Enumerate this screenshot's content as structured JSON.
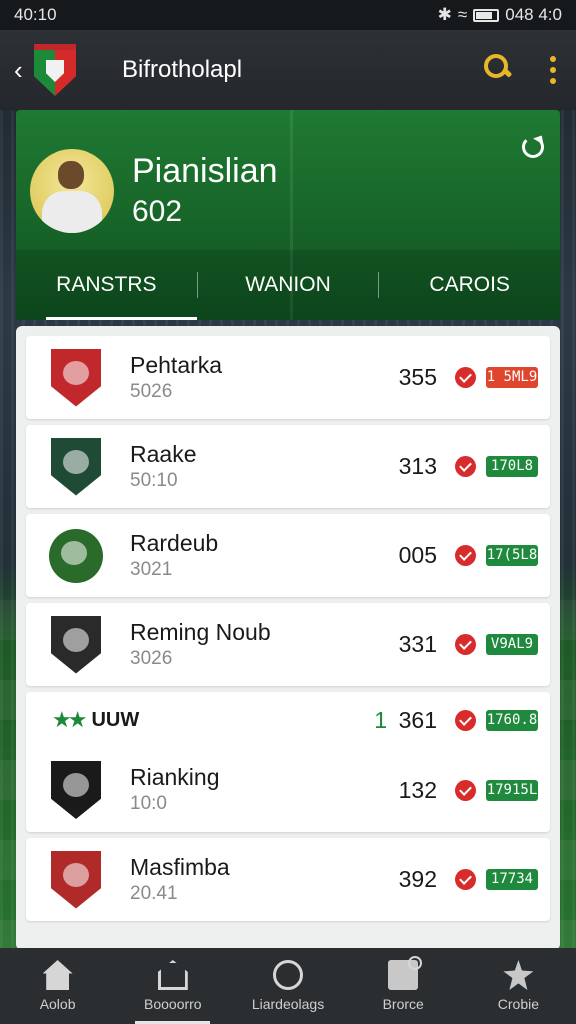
{
  "status_bar": {
    "time": "40:10",
    "right_text": "048 4:0"
  },
  "app_bar": {
    "title": "Bifrotholapl"
  },
  "hero": {
    "name": "Pianislian",
    "number": "602"
  },
  "tabs": [
    {
      "label": "RANSTRS",
      "active": true
    },
    {
      "label": "WANION",
      "active": false
    },
    {
      "label": "CAROIS",
      "active": false
    }
  ],
  "teams": [
    {
      "name": "Pehtarka",
      "sub": "5026",
      "points": "355",
      "badge": "1 5ML9",
      "badge_color": "#e0452e",
      "crest_color": "#c0282b"
    },
    {
      "name": "Raake",
      "sub": "50:10",
      "points": "313",
      "badge": "170L8",
      "badge_color": "#1f8a3e",
      "crest_color": "#1e4a36"
    },
    {
      "name": "Rardeub",
      "sub": "3021",
      "points": "005",
      "badge": "17(5L8",
      "badge_color": "#1f8a3e",
      "crest_color": "#2a6a2a"
    },
    {
      "name": "Reming Noub",
      "sub": "3026",
      "points": "331",
      "badge": "V9AL9",
      "badge_color": "#1f8a3e",
      "crest_color": "#2a2a2a"
    }
  ],
  "group": {
    "label": "UUW",
    "rank": "1",
    "rank_points": "361",
    "rank_badge": "1760.8",
    "team": {
      "name": "Rianking",
      "sub": "10:0",
      "points": "132",
      "badge": "17915L",
      "badge_color": "#1f8a3e",
      "crest_color": "#1a1a1a"
    }
  },
  "last_team": {
    "name": "Masfimba",
    "sub": "20.41",
    "points": "392",
    "badge": "17734",
    "badge_color": "#1f8a3e",
    "crest_color": "#b02a2a"
  },
  "bottom_nav": [
    {
      "label": "Aolob",
      "icon": "home-icon",
      "active": false
    },
    {
      "label": "Boooorro",
      "icon": "stadium-icon",
      "active": true
    },
    {
      "label": "Liardeolags",
      "icon": "circle-icon",
      "active": false
    },
    {
      "label": "Brorce",
      "icon": "store-icon",
      "active": false
    },
    {
      "label": "Crobie",
      "icon": "profile-icon",
      "active": false
    }
  ],
  "colors": {
    "accent": "#e8b728",
    "green": "#1d8a3a",
    "red": "#d82b2b"
  }
}
